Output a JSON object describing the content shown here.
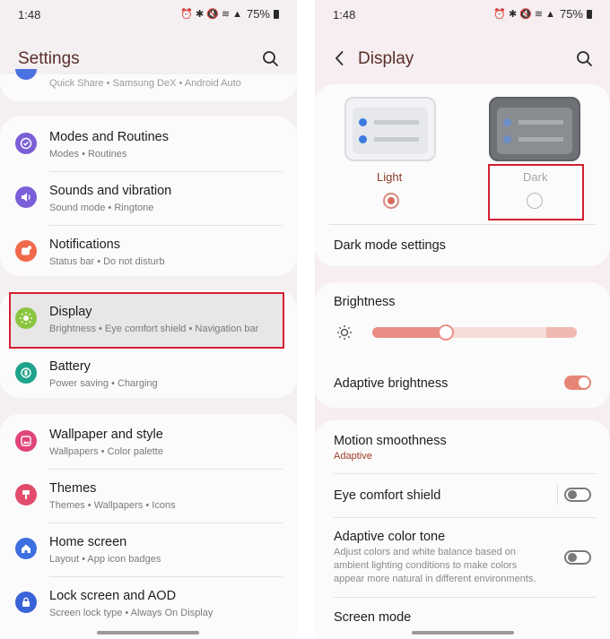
{
  "status": {
    "time": "1:48",
    "battery": "75%"
  },
  "left": {
    "header_title": "Settings",
    "partial_item_sub": "Quick Share • Samsung DeX • Android Auto",
    "group1": [
      {
        "title": "Modes and Routines",
        "sub": "Modes • Routines",
        "icon": "check-circle-icon",
        "color": "#7b5fd6"
      },
      {
        "title": "Sounds and vibration",
        "sub": "Sound mode • Ringtone",
        "icon": "speaker-icon",
        "color": "#7a5fd8"
      },
      {
        "title": "Notifications",
        "sub": "Status bar • Do not disturb",
        "icon": "notification-icon",
        "color": "#f0694a"
      }
    ],
    "group2": [
      {
        "title": "Display",
        "sub": "Brightness • Eye comfort shield • Navigation bar",
        "icon": "sun-icon",
        "color": "#8bc53f"
      },
      {
        "title": "Battery",
        "sub": "Power saving • Charging",
        "icon": "battery-icon",
        "color": "#1fa38a"
      }
    ],
    "group3": [
      {
        "title": "Wallpaper and style",
        "sub": "Wallpapers • Color palette",
        "icon": "wallpaper-icon",
        "color": "#e0457a"
      },
      {
        "title": "Themes",
        "sub": "Themes • Wallpapers • Icons",
        "icon": "themes-icon",
        "color": "#e24b6b"
      },
      {
        "title": "Home screen",
        "sub": "Layout • App icon badges",
        "icon": "home-icon",
        "color": "#3d6fe0"
      },
      {
        "title": "Lock screen and AOD",
        "sub": "Screen lock type • Always On Display",
        "icon": "lock-icon",
        "color": "#3a63d8"
      }
    ]
  },
  "right": {
    "header_title": "Display",
    "mode_light_label": "Light",
    "mode_dark_label": "Dark",
    "dark_mode_settings": "Dark mode settings",
    "brightness_label": "Brightness",
    "brightness_level": 0.36,
    "adaptive_brightness": "Adaptive brightness",
    "adaptive_brightness_on": true,
    "motion_smoothness": "Motion smoothness",
    "motion_smoothness_value": "Adaptive",
    "eye_comfort": "Eye comfort shield",
    "eye_comfort_on": false,
    "adaptive_tone": "Adaptive color tone",
    "adaptive_tone_desc": "Adjust colors and white balance based on ambient lighting conditions to make colors appear more natural in different environments.",
    "adaptive_tone_on": false,
    "screen_mode": "Screen mode"
  }
}
